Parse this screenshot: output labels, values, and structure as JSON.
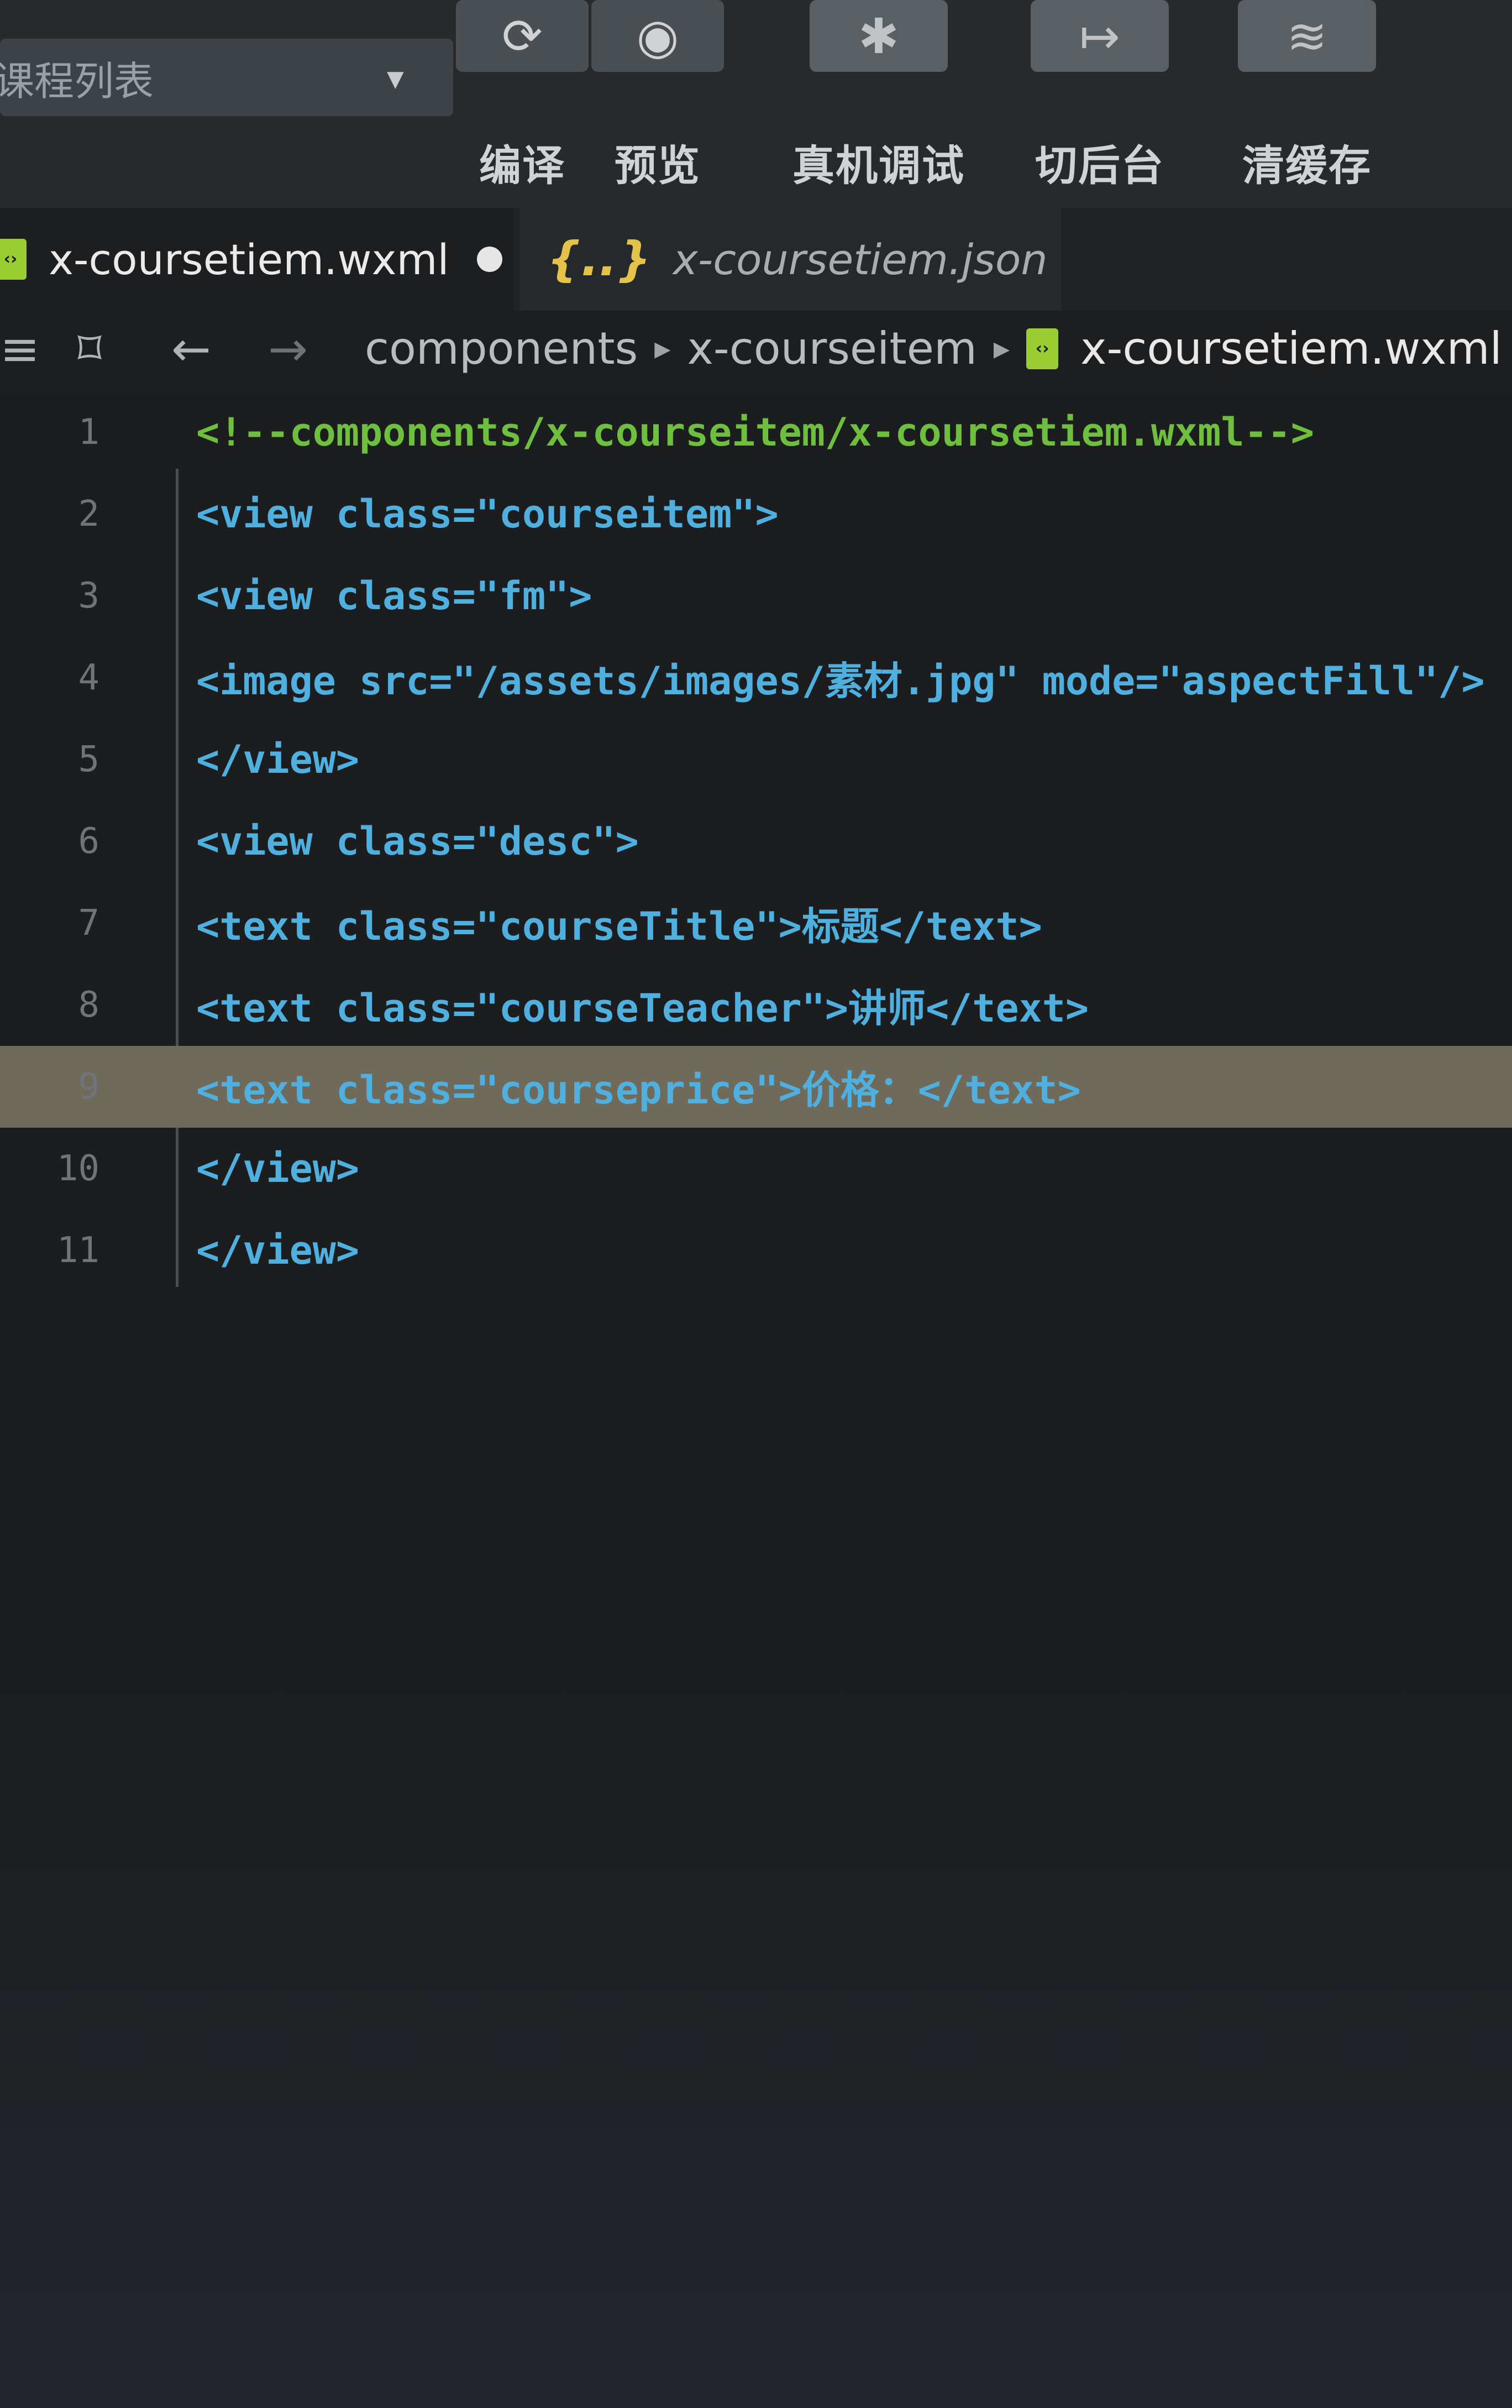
{
  "toolbar": {
    "select_label": "课程列表",
    "buttons": [
      {
        "icon": "refresh-icon",
        "glyph": "⟳",
        "label": "编译"
      },
      {
        "icon": "eye-icon",
        "glyph": "◉",
        "label": "预览"
      },
      {
        "icon": "bug-icon",
        "glyph": "✱",
        "label": "真机调试"
      },
      {
        "icon": "backstage-icon",
        "glyph": "↦",
        "label": "切后台"
      },
      {
        "icon": "layers-icon",
        "glyph": "≋",
        "label": "清缓存"
      }
    ]
  },
  "tabs": [
    {
      "label": "x-coursetiem.wxml",
      "active": true,
      "modified": true
    },
    {
      "label": "x-coursetiem.json",
      "active": false
    }
  ],
  "breadcrumb": {
    "parts": [
      "components",
      "x-courseitem"
    ],
    "file": "x-coursetiem.wxml"
  },
  "editor": {
    "current_line": 9,
    "lines": [
      {
        "n": "1",
        "t": "<!--components/x-courseitem/x-coursetiem.wxml-->"
      },
      {
        "n": "2",
        "t": "<view class=\"courseitem\">"
      },
      {
        "n": "3",
        "t": "<view class=\"fm\">"
      },
      {
        "n": "4",
        "t": "<image src=\"/assets/images/素材.jpg\" mode=\"aspectFill\"/>"
      },
      {
        "n": "5",
        "t": "</view>"
      },
      {
        "n": "6",
        "t": "<view class=\"desc\">"
      },
      {
        "n": "7",
        "t": "<text class=\"courseTitle\">标题</text>"
      },
      {
        "n": "8",
        "t": "<text class=\"courseTeacher\">讲师</text>"
      },
      {
        "n": "9",
        "t": "<text class=\"courseprice\">价格：</text>"
      },
      {
        "n": "10",
        "t": "</view>"
      },
      {
        "n": "11",
        "t": "</view>"
      }
    ]
  },
  "colors": {
    "tag": "#4fb0e0",
    "string": "#f07a3a",
    "comment": "#6fbf3f",
    "current_line": "#6f6a5a"
  }
}
